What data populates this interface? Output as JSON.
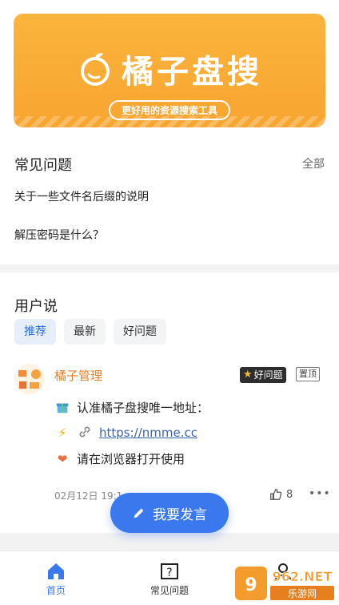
{
  "banner": {
    "brand": "橘子盘搜",
    "slogan": "更好用的资源搜索工具"
  },
  "faq": {
    "title": "常见问题",
    "all_link": "全部",
    "items": [
      "关于一些文件名后缀的说明",
      "解压密码是什么？"
    ]
  },
  "users": {
    "title": "用户说",
    "tabs": [
      "推荐",
      "最新",
      "好问题"
    ],
    "post": {
      "author": "橘子管理",
      "badge_good": "好问题",
      "badge_top": "置顶",
      "lines": [
        "认准橘子盘搜唯一地址：",
        "https://nmme.cc",
        "请在浏览器打开使用"
      ],
      "date": "02月12日 19:1",
      "likes": "8"
    }
  },
  "fab": {
    "label": "我要发言"
  },
  "tabbar": {
    "home": "首页",
    "faq": "常见问题",
    "mine": "我"
  },
  "watermark": {
    "text_top": "962.NET",
    "text_bottom": "乐游网"
  },
  "colors": {
    "accent": "#3a78ee",
    "banner": "#f7a530",
    "author": "#e3812c"
  }
}
